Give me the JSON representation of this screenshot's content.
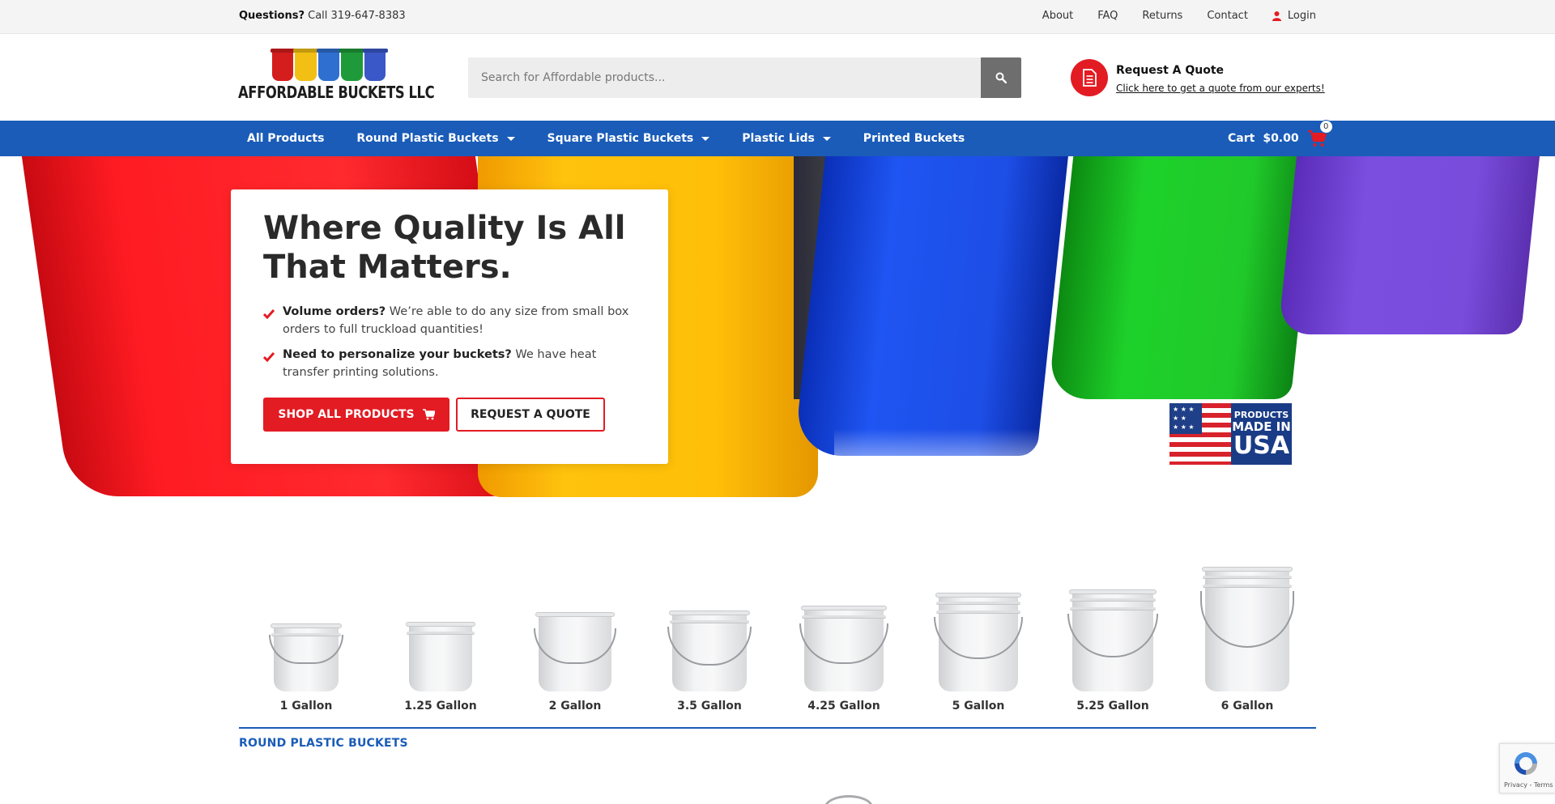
{
  "topbar": {
    "questions_label": "Questions?",
    "phone_text": "Call 319-647-8383",
    "links": [
      "About",
      "FAQ",
      "Returns",
      "Contact"
    ],
    "login_label": "Login"
  },
  "header": {
    "logo_text": "AFFORDABLE BUCKETS LLC",
    "search_placeholder": "Search for Affordable products...",
    "quote_title": "Request A Quote",
    "quote_link": "Click here to get a quote from our experts!"
  },
  "nav": {
    "items": [
      {
        "label": "All Products",
        "dropdown": false
      },
      {
        "label": "Round Plastic Buckets",
        "dropdown": true
      },
      {
        "label": "Square Plastic Buckets",
        "dropdown": true
      },
      {
        "label": "Plastic Lids",
        "dropdown": true
      },
      {
        "label": "Printed Buckets",
        "dropdown": false
      }
    ],
    "cart_label": "Cart",
    "cart_total": "$0.00",
    "cart_count": "0"
  },
  "hero": {
    "title": "Where Quality Is All That Matters.",
    "bullets": [
      {
        "bold": "Volume orders?",
        "text": " We’re able to do any size from small box orders to full truckload quantities!"
      },
      {
        "bold": "Need to personalize your buckets?",
        "text": " We have heat transfer printing solutions."
      }
    ],
    "shop_button": "SHOP ALL PRODUCTS",
    "quote_button": "REQUEST A QUOTE",
    "usa_badge": {
      "line1": "PRODUCTS",
      "line2": "MADE IN",
      "line3": "USA"
    }
  },
  "sizes": [
    {
      "label": "1 Gallon"
    },
    {
      "label": "1.25 Gallon"
    },
    {
      "label": "2 Gallon"
    },
    {
      "label": "3.5 Gallon"
    },
    {
      "label": "4.25 Gallon"
    },
    {
      "label": "5 Gallon"
    },
    {
      "label": "5.25 Gallon"
    },
    {
      "label": "6 Gallon"
    }
  ],
  "section_title": "ROUND PLASTIC BUCKETS",
  "recaptcha": {
    "text": "Privacy - Terms"
  },
  "colors": {
    "accent_red": "#e31b23",
    "nav_blue": "#1a5cb8"
  }
}
